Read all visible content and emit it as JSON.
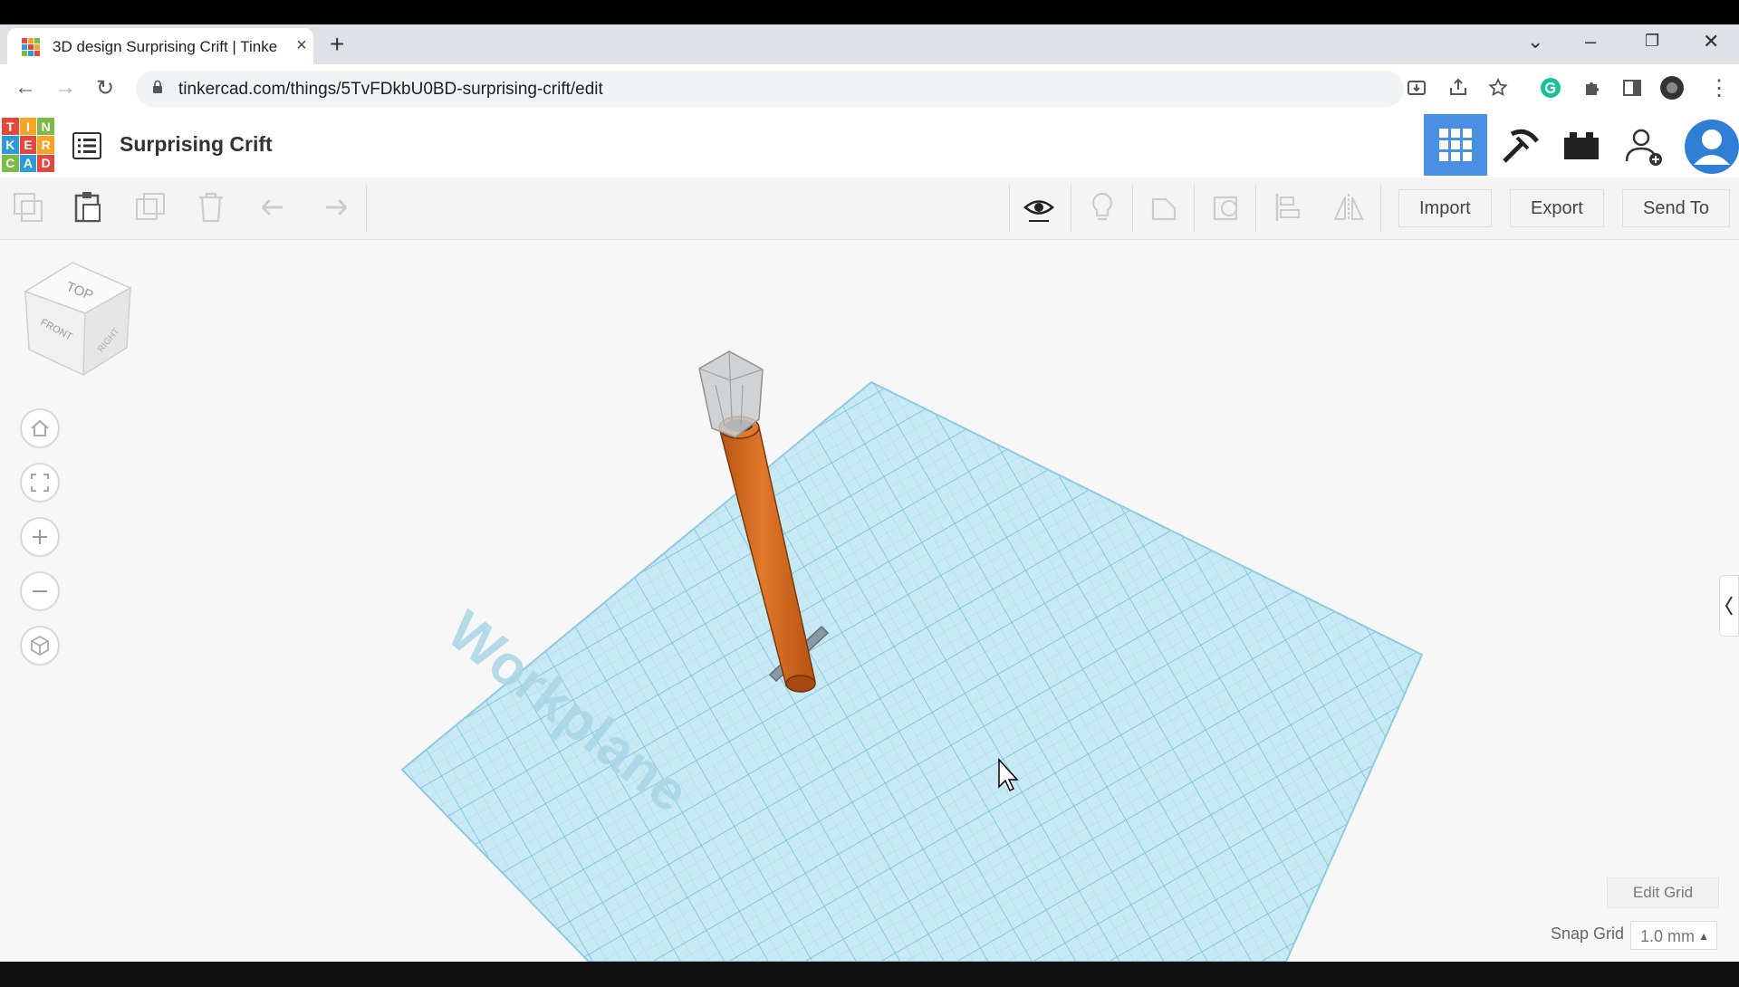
{
  "browser": {
    "tab_title": "3D design Surprising Crift | Tinke",
    "url": "tinkercad.com/things/5TvFDkbU0BD-surprising-crift/edit"
  },
  "app": {
    "logo_letters": [
      "T",
      "I",
      "N",
      "K",
      "E",
      "R",
      "C",
      "A",
      "D"
    ],
    "design_title": "Surprising Crift"
  },
  "toolbar": {
    "import_label": "Import",
    "export_label": "Export",
    "send_to_label": "Send To"
  },
  "viewcube": {
    "top_label": "TOP",
    "front_label": "FRONT",
    "right_label": "RIGHT"
  },
  "workplane": {
    "label": "Workplane"
  },
  "grid": {
    "edit_label": "Edit Grid",
    "snap_label": "Snap Grid",
    "snap_value": "1.0 mm"
  },
  "colors": {
    "accent": "#4a90e2",
    "workplane": "#bfe6f2",
    "shape": "#d4691c",
    "logo_red": "#e2483d",
    "logo_orange": "#f7a325",
    "logo_green": "#79bd48",
    "logo_blue": "#2c9bd6"
  }
}
